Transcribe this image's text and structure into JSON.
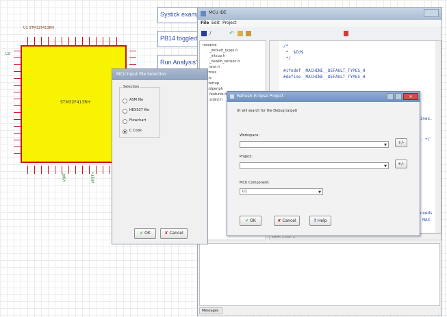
{
  "schematic": {
    "component_ref": "U1 STM32F413RH",
    "chip_name": "STM32F413RH",
    "left_label": "LSI",
    "net_labels": [
      "VBAT",
      "VREF+"
    ]
  },
  "notes": [
    "Systick examp",
    "PB14 toggled",
    "Run Analysis?"
  ],
  "mcu_ide": {
    "title": "MCU IDE",
    "menu": [
      "File",
      "Edit",
      "Project"
    ],
    "tree": [
      "noname",
      "_default_types.h",
      "_intsup.h",
      "_newlib_version.h",
      "ansi.h",
      "cmsis",
      "src",
      "startup",
      "stdperiph",
      "features.h",
      "stdint.h"
    ],
    "code_lines": [
      "/*",
      " *  $Id$",
      " */",
      "",
      "#ifndef _MACHINE__DEFAULT_TYPES_H",
      "#define _MACHINE__DEFAULT_TYPES_H"
    ],
    "code_fragments": [
      "fines.",
      "t. +/",
      "/",
      "xceeds i",
      "E MAX"
    ],
    "status": "Line: 1  Col: 1",
    "messages_tab": "Messages"
  },
  "input_dialog": {
    "title": "MCU Input File Selection",
    "group": "Selection",
    "options": [
      "ASM file",
      "HEXS37 file",
      "Flowchart",
      "C Code"
    ],
    "selected": "C Code",
    "ok": "OK",
    "cancel": "Cancel"
  },
  "eclipse_dialog": {
    "title": "Refresh Eclipse Project",
    "hint": "(It will search for the Debug target)",
    "workspace_label": "Workspace:",
    "project_label": "Project:",
    "component_label": "MCU Component:",
    "component_value": "U1",
    "browse": "+/-",
    "ok": "OK",
    "cancel": "Cancel",
    "help": "Help"
  }
}
